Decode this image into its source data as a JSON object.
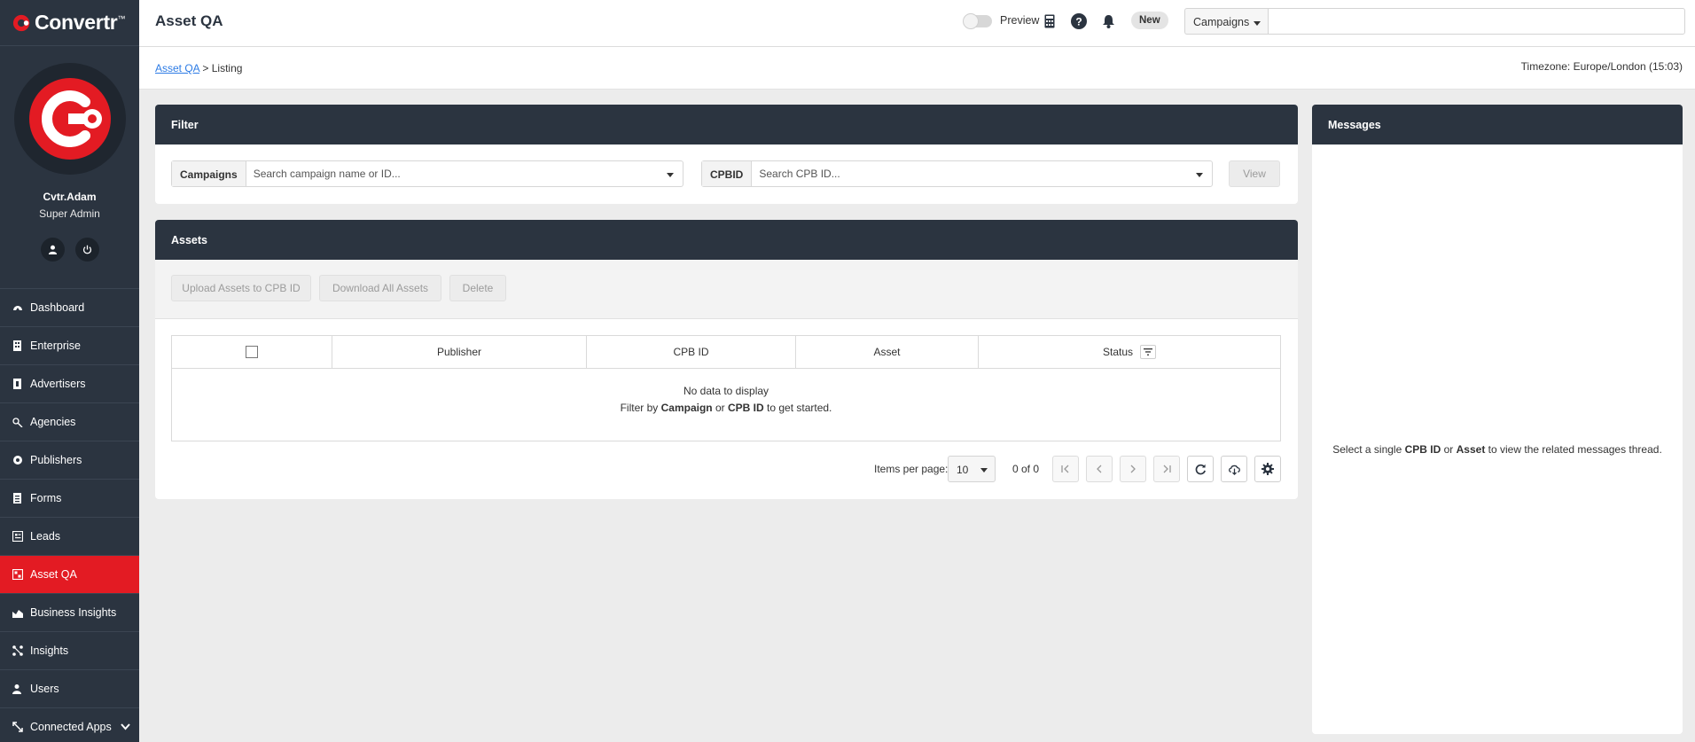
{
  "app": {
    "brand": "Convertr",
    "brand_mark": "™",
    "accent": "#e31b23",
    "sidebar_bg": "#2b3440"
  },
  "user": {
    "name": "Cvtr.Adam",
    "role": "Super Admin"
  },
  "nav": [
    {
      "label": "Dashboard",
      "icon": "dashboard-icon"
    },
    {
      "label": "Enterprise",
      "icon": "enterprise-icon"
    },
    {
      "label": "Advertisers",
      "icon": "advertisers-icon"
    },
    {
      "label": "Agencies",
      "icon": "agencies-icon"
    },
    {
      "label": "Publishers",
      "icon": "publishers-icon"
    },
    {
      "label": "Forms",
      "icon": "forms-icon"
    },
    {
      "label": "Leads",
      "icon": "leads-icon"
    },
    {
      "label": "Asset QA",
      "icon": "asset-qa-icon",
      "active": true
    },
    {
      "label": "Business Insights",
      "icon": "business-insights-icon"
    },
    {
      "label": "Insights",
      "icon": "insights-icon"
    },
    {
      "label": "Users",
      "icon": "users-icon"
    },
    {
      "label": "Connected Apps",
      "icon": "connected-apps-icon"
    }
  ],
  "topbar": {
    "title": "Asset QA",
    "preview_label": "Preview",
    "new_label": "New",
    "scope_select": "Campaigns",
    "search_value": ""
  },
  "breadcrumb": {
    "link": "Asset QA",
    "separator": ">",
    "current": "Listing"
  },
  "timezone": "Timezone: Europe/London (15:03)",
  "filter": {
    "title": "Filter",
    "campaigns_label": "Campaigns",
    "campaigns_placeholder": "Search campaign name or ID...",
    "cpbid_label": "CPBID",
    "cpbid_placeholder": "Search CPB ID...",
    "view_label": "View"
  },
  "assets": {
    "title": "Assets",
    "buttons": {
      "upload": "Upload Assets to CPB ID",
      "download": "Download All Assets",
      "delete": "Delete"
    },
    "columns": [
      "Publisher",
      "CPB ID",
      "Asset",
      "Status"
    ],
    "empty": {
      "line1": "No data to display",
      "prefix": "Filter by",
      "campaign": "Campaign",
      "or": "or",
      "cpbid": "CPB ID",
      "suffix": "to get started."
    },
    "pager": {
      "items_per_page_label": "Items per page:",
      "items_per_page": "10",
      "range": "0 of 0"
    }
  },
  "messages": {
    "title": "Messages",
    "prefix": "Select a single",
    "cpbid": "CPB ID",
    "or": "or",
    "asset": "Asset",
    "suffix": "to view the related messages thread."
  }
}
